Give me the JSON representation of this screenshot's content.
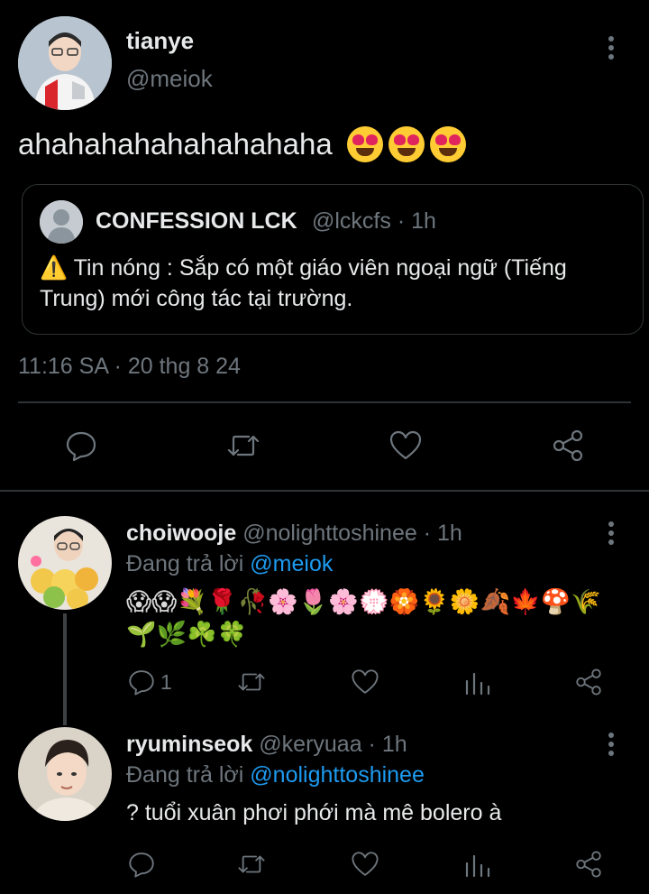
{
  "main_tweet": {
    "display_name": "tianye",
    "handle": "@meiok",
    "text": "ahahahahahahahahaha",
    "emojis": [
      "heart-eyes",
      "heart-eyes",
      "heart-eyes"
    ],
    "timestamp": "11:16 SA · 20 thg 8 24",
    "quote": {
      "display_name": "CONFESSION LCK",
      "handle_time": "@lckcfs · 1h",
      "text": "⚠️ Tin nóng : Sắp có một giáo viên ngoại ngữ (Tiếng Trung) mới công tác tại trường."
    }
  },
  "replies": [
    {
      "display_name": "choiwooje",
      "handle_time": "@nolighttoshinee · 1h",
      "replying_prefix": "Đang trả lời",
      "replying_to": "@meiok",
      "emoji_text": "😱😱💐🌹🥀🌸🌷🌸💮🏵️🌻🌼🍂🍁🍄🌾🌱🌿☘️🍀",
      "reply_count": "1"
    },
    {
      "display_name": "ryuminseok",
      "handle_time": "@keryuaa · 1h",
      "replying_prefix": "Đang trả lời",
      "replying_to": "@nolighttoshinee",
      "text": "? tuổi xuân phơi phới mà mê bolero à"
    }
  ],
  "colors": {
    "background": "#000000",
    "primary_text": "#e7e9ea",
    "secondary_text": "#6e767d",
    "link": "#1d9bf0",
    "divider": "#2f3336"
  },
  "icons": [
    "more-icon",
    "reply-icon",
    "retweet-icon",
    "like-icon",
    "share-icon",
    "analytics-icon"
  ]
}
